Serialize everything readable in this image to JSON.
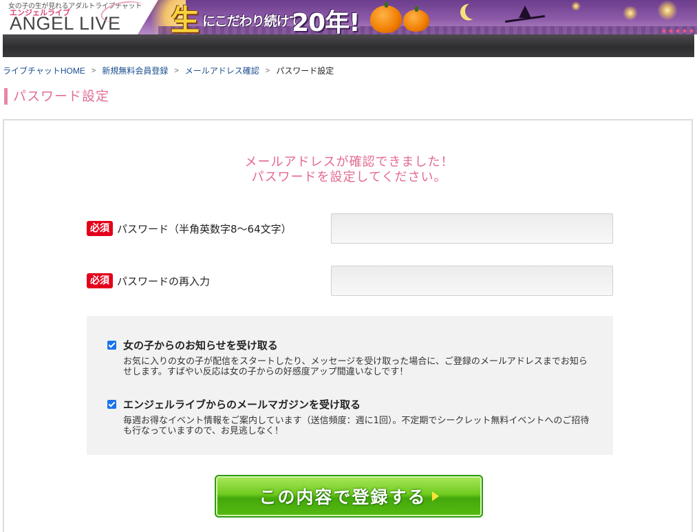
{
  "header": {
    "tagline": "女の子の生が見れるアダルトライブチャット",
    "brand_kana": "エンジェルライブ",
    "brand_logo": "ANGEL LIVE",
    "slogan_kanji": "生",
    "slogan_text": "にこだわり続けて",
    "slogan_years": "20年!"
  },
  "breadcrumb": [
    {
      "label": "ライブチャットHOME",
      "link": true
    },
    {
      "label": "新規無料会員登録",
      "link": true
    },
    {
      "label": "メールアドレス確認",
      "link": true
    },
    {
      "label": "パスワード設定",
      "link": false
    }
  ],
  "breadcrumb_separator": ">",
  "page_title": "パスワード設定",
  "headline": {
    "line1": "メールアドレスが確認できました！",
    "line2": "パスワードを設定してください。"
  },
  "fields": {
    "required_badge": "必須",
    "password": {
      "label": "パスワード（半角英数字8〜64文字）",
      "value": ""
    },
    "password_confirm": {
      "label": "パスワードの再入力",
      "value": ""
    }
  },
  "options": [
    {
      "checked": true,
      "title": "女の子からのお知らせを受け取る",
      "description": "お気に入りの女の子が配信をスタートしたり、メッセージを受け取った場合に、ご登録のメールアドレスまでお知らせします。すばやい反応は女の子からの好感度アップ間違いなしです！"
    },
    {
      "checked": true,
      "title": "エンジェルライブからのメールマガジンを受け取る",
      "description": "毎週お得なイベント情報をご案内しています（送信頻度：週に1回）。不定期でシークレット無料イベントへのご招待も行なっていますので、お見逃しなく！"
    }
  ],
  "submit_label": "この内容で登録する",
  "colors": {
    "accent_pink": "#e06f91",
    "required_red": "#e3001b",
    "button_green": "#56ba12",
    "link_blue": "#1a4d8f"
  }
}
